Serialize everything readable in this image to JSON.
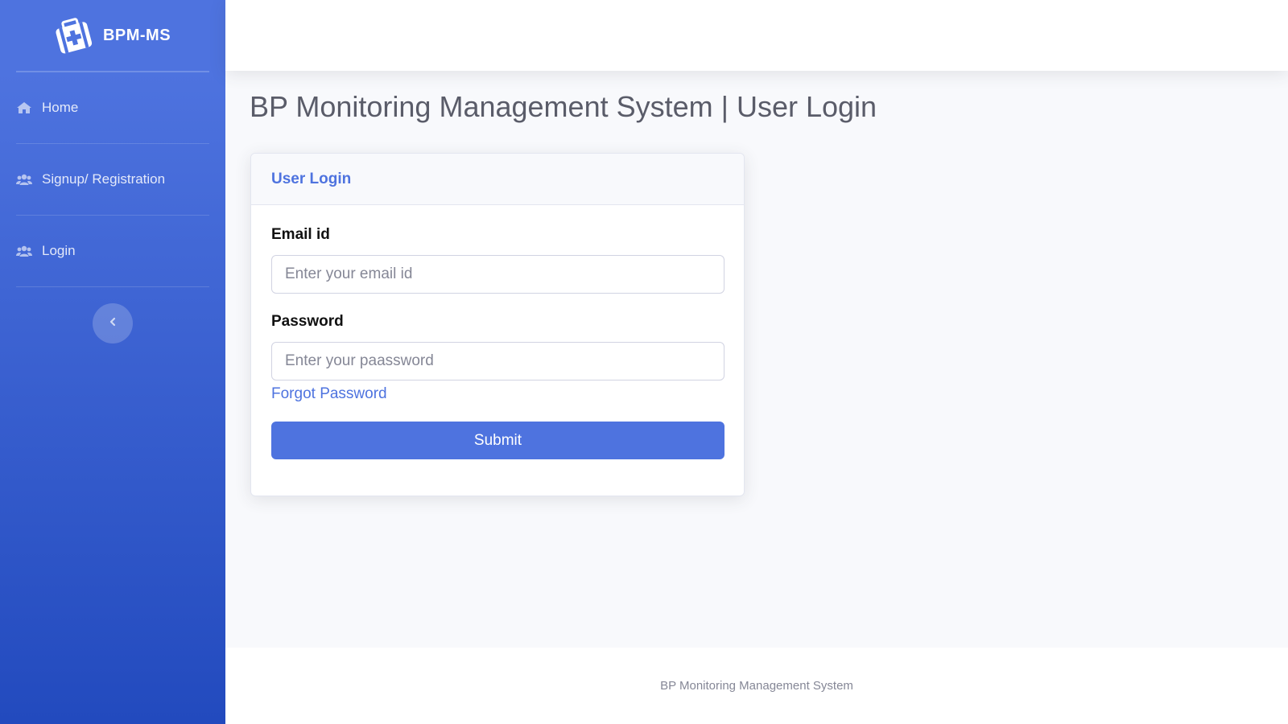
{
  "sidebar": {
    "brand": {
      "name": "BPM-MS",
      "icon": "medkit-icon"
    },
    "items": [
      {
        "label": "Home",
        "icon": "home-icon"
      },
      {
        "label": "Signup/ Registration",
        "icon": "users-icon"
      },
      {
        "label": "Login",
        "icon": "users-icon"
      }
    ],
    "toggle_icon": "chevron-left-icon"
  },
  "main": {
    "page_title": "BP Monitoring Management System | User Login",
    "login_card": {
      "header": "User Login",
      "email": {
        "label": "Email id",
        "placeholder": "Enter your email id",
        "value": ""
      },
      "password": {
        "label": "Password",
        "placeholder": "Enter your paassword",
        "value": ""
      },
      "forgot_link": "Forgot Password",
      "submit_label": "Submit"
    }
  },
  "footer": {
    "text": "BP Monitoring Management System"
  },
  "colors": {
    "primary": "#4e73df",
    "sidebar_gradient_start": "#4e73df",
    "sidebar_gradient_end": "#224abe",
    "background": "#f8f9fc",
    "heading_text": "#5a5c69",
    "muted_text": "#858796"
  }
}
